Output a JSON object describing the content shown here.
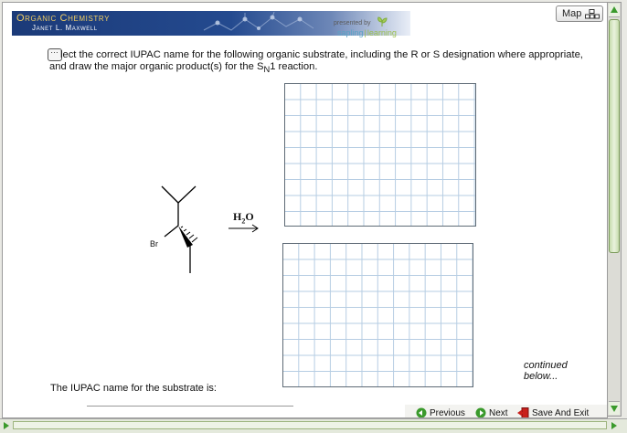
{
  "banner": {
    "title": "Organic Chemistry",
    "author": "Janet L. Maxwell",
    "presented_by": "presented by",
    "brand_part1": "sapling",
    "brand_part2": "learning"
  },
  "toolbar": {
    "map_label": "Map"
  },
  "question": {
    "text_pre": "lect the correct IUPAC name for the following organic substrate, including the R or S designation where appropriate, and draw the major organic product(s) for the S",
    "text_sub": "N",
    "text_post": "1 reaction."
  },
  "molecule": {
    "atom_label": "Br"
  },
  "reagent": {
    "h": "H",
    "sub": "2",
    "o": "O"
  },
  "continued": {
    "text": "continued below..."
  },
  "answer": {
    "label": "The IUPAC name for the substrate is:"
  },
  "nav": {
    "previous": "Previous",
    "next": "Next",
    "save_exit": "Save And Exit"
  },
  "colors": {
    "banner": "#1b3a78",
    "accent": "#f3cf63",
    "grid_line": "#b6cde3",
    "nav_green": "#3a9a2c",
    "exit_red": "#c8201c"
  },
  "icons": [
    "speech-bubble-icon",
    "map-icon",
    "previous-arrow-icon",
    "next-arrow-icon",
    "exit-door-icon",
    "scroll-up-icon",
    "scroll-down-icon"
  ]
}
